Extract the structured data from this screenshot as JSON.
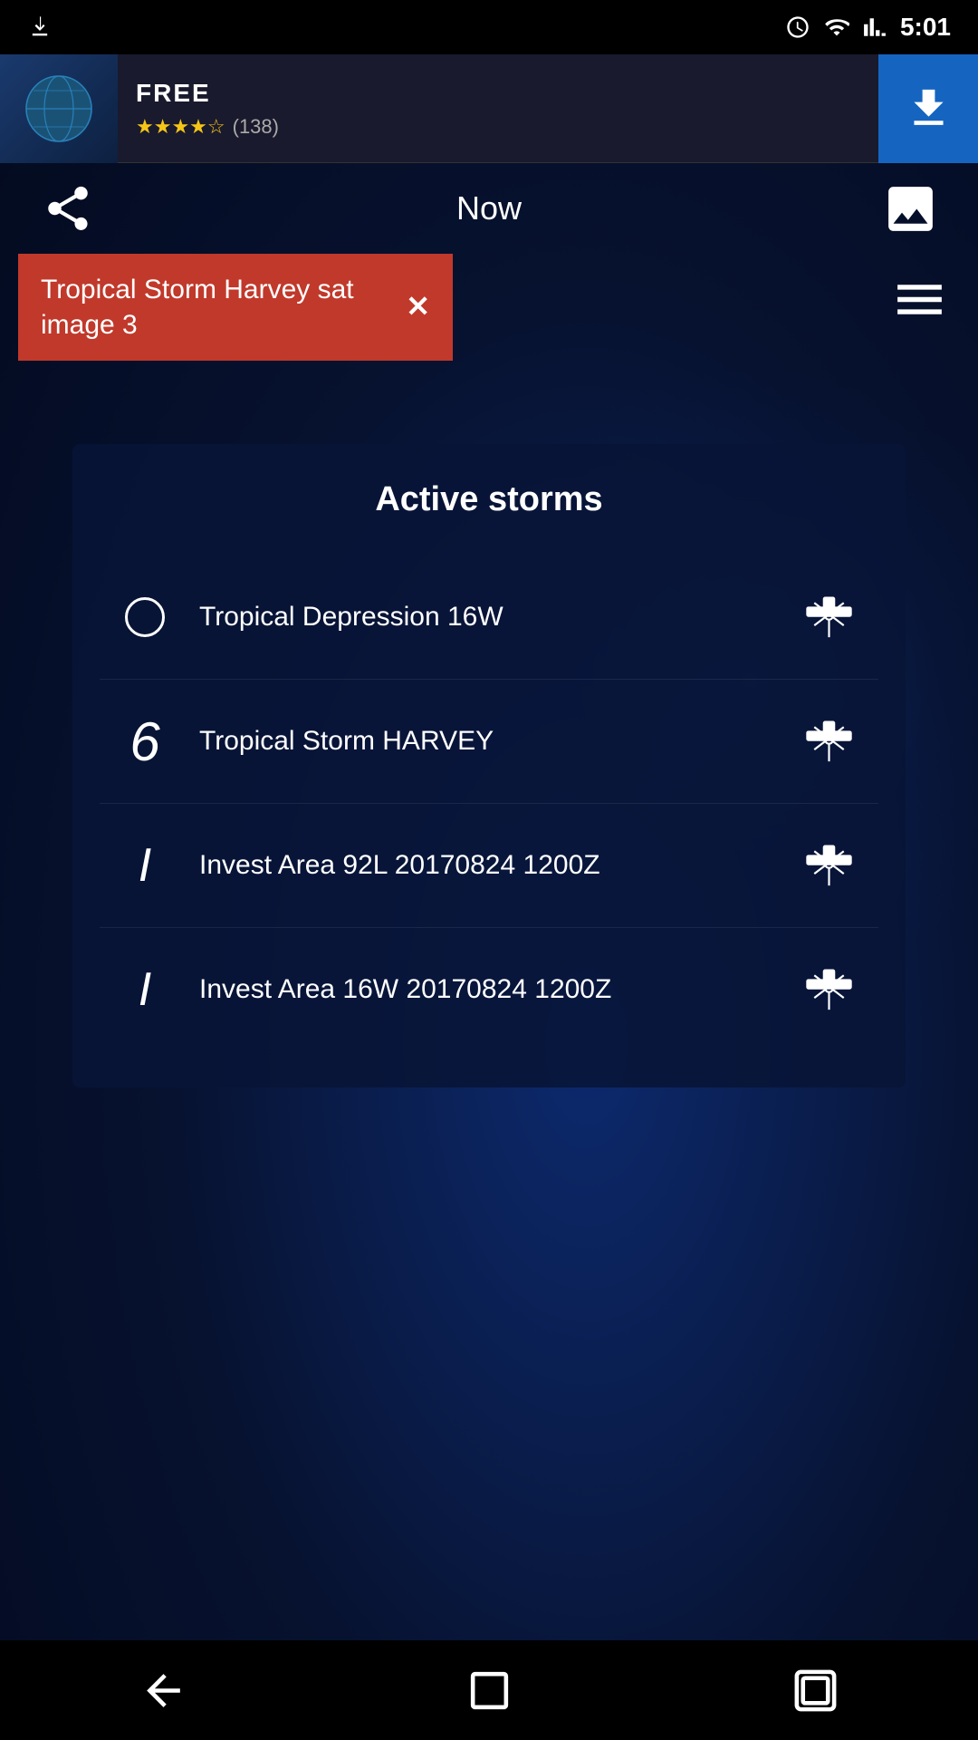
{
  "status_bar": {
    "time": "5:01",
    "icons": [
      "download-icon",
      "alarm-icon",
      "wifi-icon",
      "signal-icon",
      "battery-icon"
    ]
  },
  "ad": {
    "free_label": "FREE",
    "stars": "★★★★☆",
    "review_count": "(138)",
    "free_text": "FREE"
  },
  "toolbar": {
    "title": "Now",
    "share_icon": "share-icon",
    "image_icon": "image-icon",
    "menu_icon": "menu-icon"
  },
  "tag": {
    "text": "Tropical Storm Harvey sat image 3",
    "close_icon": "close-icon"
  },
  "panel": {
    "title": "Active storms",
    "storms": [
      {
        "name": "Tropical Depression 16W",
        "symbol_type": "circle",
        "symbol": "○"
      },
      {
        "name": "Tropical Storm HARVEY",
        "symbol_type": "number",
        "symbol": "6"
      },
      {
        "name": "Invest Area 92L 20170824 1200Z",
        "symbol_type": "italic",
        "symbol": "I"
      },
      {
        "name": "Invest Area 16W 20170824 1200Z",
        "symbol_type": "italic",
        "symbol": "I"
      }
    ]
  },
  "nav": {
    "back_icon": "back-nav-icon",
    "home_icon": "home-nav-icon",
    "recent_icon": "recent-nav-icon"
  },
  "colors": {
    "background": "#0a1a4a",
    "tag_bg": "#c0392b",
    "panel_bg": "rgba(8,20,55,0.88)",
    "ad_download_bg": "#1565c0"
  }
}
